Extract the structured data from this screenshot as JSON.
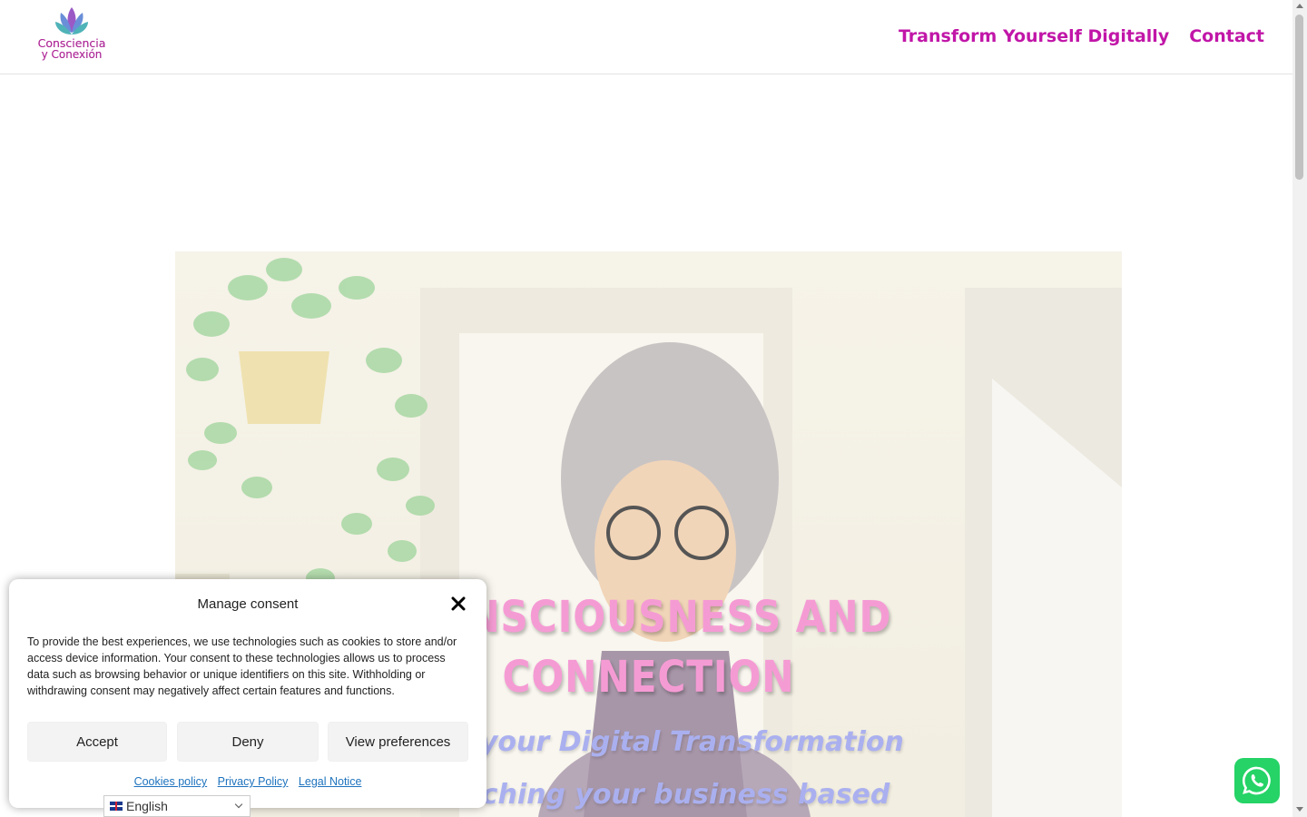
{
  "header": {
    "logo": {
      "line1": "Consciencia",
      "line2": "y Conexión"
    },
    "nav": [
      {
        "label": "Transform Yourself Digitally"
      },
      {
        "label": "Contact"
      }
    ]
  },
  "hero": {
    "title_line1": "CONSCIOUSNESS AND",
    "title_line2": "CONNECTION",
    "subtitle_line1": "Start your Digital Transformation",
    "subtitle_line2": "Launching your business based"
  },
  "consent": {
    "title": "Manage consent",
    "body": "To provide the best experiences, we use technologies such as cookies to store and/or access device information. Your consent to these technologies allows us to process data such as browsing behavior or unique identifiers on this site. Withholding or withdrawing consent may negatively affect certain features and functions.",
    "buttons": {
      "accept": "Accept",
      "deny": "Deny",
      "preferences": "View preferences"
    },
    "links": {
      "cookies": "Cookies policy",
      "privacy": "Privacy Policy",
      "legal": "Legal Notice"
    }
  },
  "language_selector": {
    "selected": "English"
  },
  "colors": {
    "brand": "#c116a8",
    "hero_title": "#f59bd4",
    "hero_subtitle": "#aab0ef",
    "whatsapp": "#25d366"
  }
}
